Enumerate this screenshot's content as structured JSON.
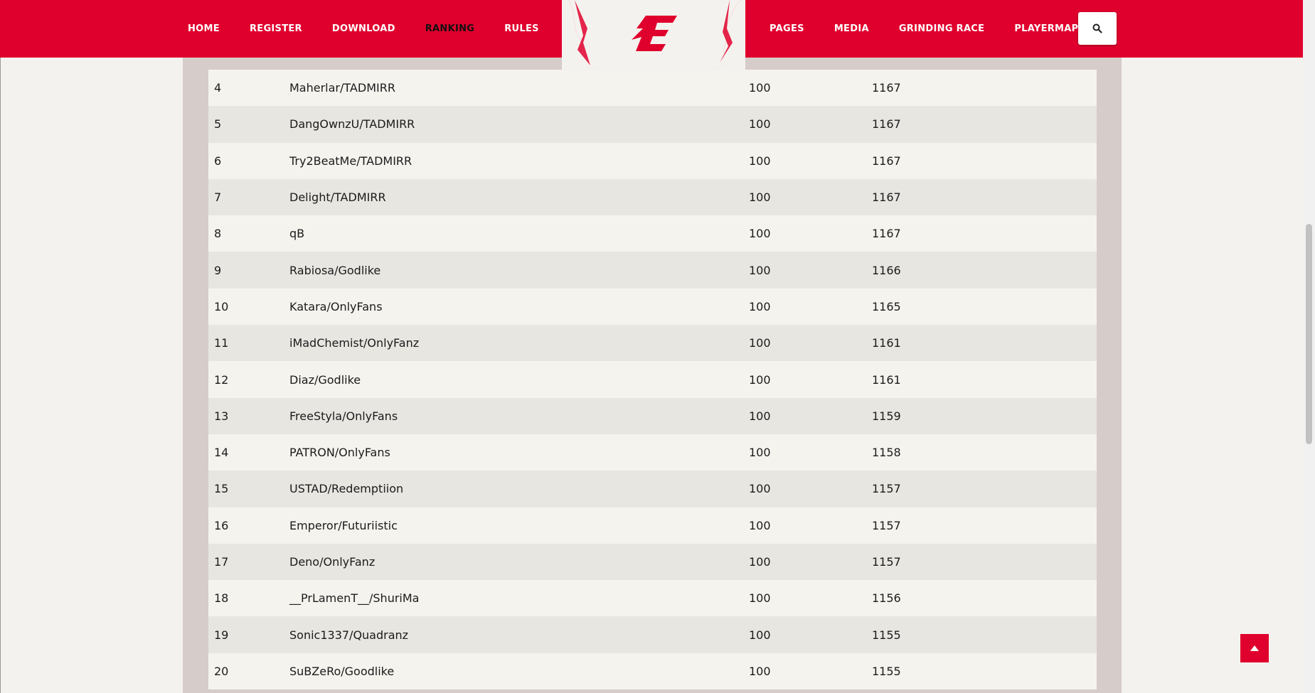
{
  "nav": {
    "left": [
      {
        "label": "HOME",
        "active": false
      },
      {
        "label": "REGISTER",
        "active": false
      },
      {
        "label": "DOWNLOAD",
        "active": false
      },
      {
        "label": "RANKING",
        "active": true
      },
      {
        "label": "RULES",
        "active": false
      }
    ],
    "right": [
      {
        "label": "PAGES"
      },
      {
        "label": "MEDIA"
      },
      {
        "label": "GRINDING RACE"
      },
      {
        "label": "PLAYERMAP"
      }
    ],
    "search_icon": "search-icon",
    "logo_icon": "logo-e-icon"
  },
  "colors": {
    "brand_red": "#e0002d",
    "row_odd": "#f5f3ee",
    "row_even": "#e8e6e1",
    "panel": "#d6ccc9"
  },
  "ranking": {
    "rows": [
      {
        "rank": "4",
        "name": "Maherlar/TADMIRR",
        "level": "100",
        "points": "1167"
      },
      {
        "rank": "5",
        "name": "DangOwnzU/TADMIRR",
        "level": "100",
        "points": "1167"
      },
      {
        "rank": "6",
        "name": "Try2BeatMe/TADMIRR",
        "level": "100",
        "points": "1167"
      },
      {
        "rank": "7",
        "name": "Delight/TADMIRR",
        "level": "100",
        "points": "1167"
      },
      {
        "rank": "8",
        "name": "qB",
        "level": "100",
        "points": "1167"
      },
      {
        "rank": "9",
        "name": "Rabiosa/Godlike",
        "level": "100",
        "points": "1166"
      },
      {
        "rank": "10",
        "name": "Katara/OnlyFans",
        "level": "100",
        "points": "1165"
      },
      {
        "rank": "11",
        "name": "iMadChemist/OnlyFanz",
        "level": "100",
        "points": "1161"
      },
      {
        "rank": "12",
        "name": "Diaz/Godlike",
        "level": "100",
        "points": "1161"
      },
      {
        "rank": "13",
        "name": "FreeStyla/OnlyFans",
        "level": "100",
        "points": "1159"
      },
      {
        "rank": "14",
        "name": "PATRON/OnlyFans",
        "level": "100",
        "points": "1158"
      },
      {
        "rank": "15",
        "name": "USTAD/Redemptiion",
        "level": "100",
        "points": "1157"
      },
      {
        "rank": "16",
        "name": "Emperor/Futuriistic",
        "level": "100",
        "points": "1157"
      },
      {
        "rank": "17",
        "name": "Deno/OnlyFanz",
        "level": "100",
        "points": "1157"
      },
      {
        "rank": "18",
        "name": "__PrLamenT__/ShuriMa",
        "level": "100",
        "points": "1156"
      },
      {
        "rank": "19",
        "name": "Sonic1337/Quadranz",
        "level": "100",
        "points": "1155"
      },
      {
        "rank": "20",
        "name": "SuBZeRo/Goodlike",
        "level": "100",
        "points": "1155"
      }
    ]
  },
  "back_to_top_icon": "arrow-up-icon"
}
